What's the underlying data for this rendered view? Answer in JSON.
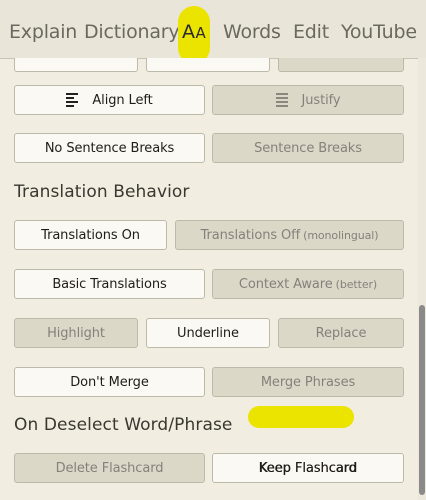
{
  "tabs": [
    {
      "label": "Explain"
    },
    {
      "label": "Dictionary"
    },
    {
      "label": "AA",
      "active": true
    },
    {
      "label": "Words"
    },
    {
      "label": "Edit"
    },
    {
      "label": "YouTube"
    }
  ],
  "alignment": {
    "left_label": "Align Left",
    "justify_label": "Justify",
    "selected": "Align Left"
  },
  "sentence_breaks": {
    "no_breaks_label": "No Sentence Breaks",
    "breaks_label": "Sentence Breaks",
    "selected": "No Sentence Breaks"
  },
  "translation_behavior": {
    "heading": "Translation Behavior",
    "on_label": "Translations On",
    "off_label": "Translations Off",
    "off_note": "(monolingual)",
    "basic_label": "Basic Translations",
    "context_label": "Context Aware",
    "context_note": "(better)",
    "highlight_label": "Highlight",
    "underline_label": "Underline",
    "replace_label": "Replace",
    "dont_merge_label": "Don't Merge",
    "merge_label": "Merge Phrases",
    "selected": [
      "Translations On",
      "Basic Translations",
      "Underline",
      "Don't Merge"
    ]
  },
  "deselect": {
    "heading": "On Deselect Word/Phrase",
    "delete_label": "Delete Flashcard",
    "keep_label": "Keep Flashcard",
    "selected": "Keep Flashcard"
  },
  "colors": {
    "highlight": "#ebe300",
    "selected_button": "#fbf9f3",
    "unselected_button": "#dcd8c8",
    "background": "#f1eee1"
  },
  "icons": [
    "align-left-icon",
    "justify-icon"
  ]
}
